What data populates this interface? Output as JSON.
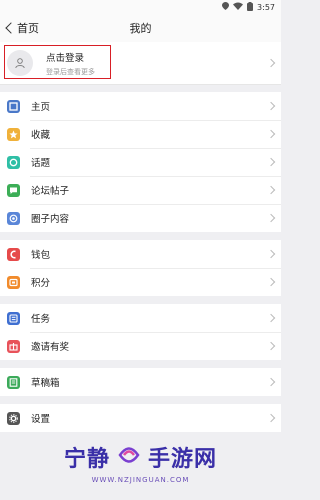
{
  "status": {
    "time": "3:57"
  },
  "nav": {
    "back_label": "首页",
    "title": "我的"
  },
  "login": {
    "title": "点击登录",
    "subtitle": "登录后查看更多"
  },
  "groups": [
    [
      {
        "label": "主页",
        "icon": "home-icon",
        "color": "#4a78c8"
      },
      {
        "label": "收藏",
        "icon": "star-icon",
        "color": "#f0b13a"
      },
      {
        "label": "话题",
        "icon": "topic-icon",
        "color": "#2fbfa6"
      },
      {
        "label": "论坛帖子",
        "icon": "chat-icon",
        "color": "#3cae57"
      },
      {
        "label": "圈子内容",
        "icon": "circle-icon",
        "color": "#5a86d8"
      }
    ],
    [
      {
        "label": "钱包",
        "icon": "wallet-icon",
        "color": "#e64a4a"
      },
      {
        "label": "积分",
        "icon": "points-icon",
        "color": "#f18b2c"
      }
    ],
    [
      {
        "label": "任务",
        "icon": "task-icon",
        "color": "#3f6fd1"
      },
      {
        "label": "邀请有奖",
        "icon": "gift-icon",
        "color": "#e8525a"
      }
    ],
    [
      {
        "label": "草稿箱",
        "icon": "draft-icon",
        "color": "#3caa5a"
      }
    ],
    [
      {
        "label": "设置",
        "icon": "gear-icon",
        "color": "#555555"
      }
    ]
  ],
  "watermark": {
    "left": "宁静",
    "right": "手游网",
    "url": "WWW.NZJINGUAN.COM"
  }
}
